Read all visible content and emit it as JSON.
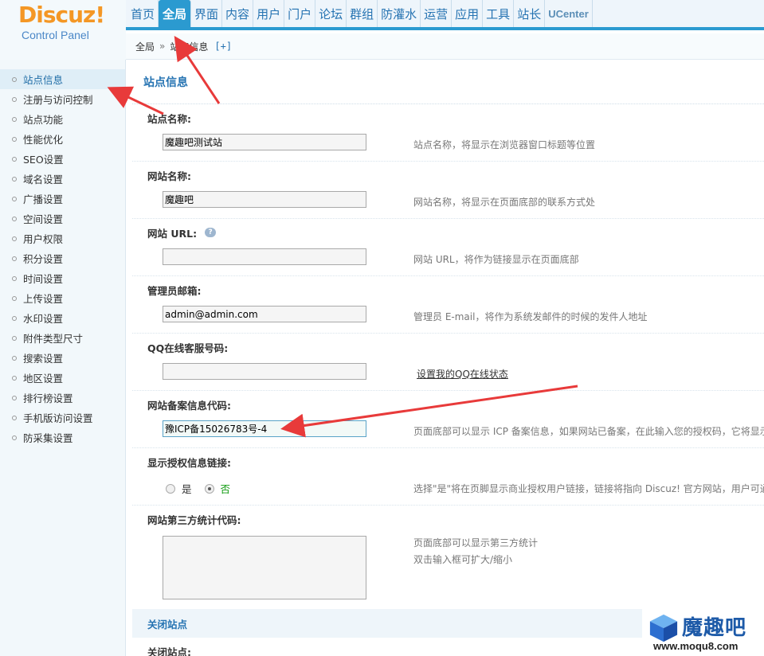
{
  "logo": {
    "brand": "Discuz!",
    "subtitle": "Control Panel"
  },
  "topnav": {
    "items": [
      {
        "label": "首页"
      },
      {
        "label": "全局"
      },
      {
        "label": "界面"
      },
      {
        "label": "内容"
      },
      {
        "label": "用户"
      },
      {
        "label": "门户"
      },
      {
        "label": "论坛"
      },
      {
        "label": "群组"
      },
      {
        "label": "防灌水"
      },
      {
        "label": "运营"
      },
      {
        "label": "应用"
      },
      {
        "label": "工具"
      },
      {
        "label": "站长"
      },
      {
        "label": "UCenter"
      }
    ],
    "active": "全局"
  },
  "breadcrumb": {
    "root": "全局",
    "separator": "»",
    "current": "站点信息",
    "add": "[+]"
  },
  "sidebar": {
    "items": [
      {
        "label": "站点信息"
      },
      {
        "label": "注册与访问控制"
      },
      {
        "label": "站点功能"
      },
      {
        "label": "性能优化"
      },
      {
        "label": "SEO设置"
      },
      {
        "label": "域名设置"
      },
      {
        "label": "广播设置"
      },
      {
        "label": "空间设置"
      },
      {
        "label": "用户权限"
      },
      {
        "label": "积分设置"
      },
      {
        "label": "时间设置"
      },
      {
        "label": "上传设置"
      },
      {
        "label": "水印设置"
      },
      {
        "label": "附件类型尺寸"
      },
      {
        "label": "搜索设置"
      },
      {
        "label": "地区设置"
      },
      {
        "label": "排行榜设置"
      },
      {
        "label": "手机版访问设置"
      },
      {
        "label": "防采集设置"
      }
    ],
    "active": "站点信息"
  },
  "main": {
    "title": "站点信息",
    "fields": {
      "site_name": {
        "label": "站点名称:",
        "value": "魔趣吧测试站",
        "tip": "站点名称，将显示在浏览器窗口标题等位置"
      },
      "web_name": {
        "label": "网站名称:",
        "value": "魔趣吧",
        "tip": "网站名称，将显示在页面底部的联系方式处"
      },
      "web_url": {
        "label": "网站 URL:",
        "value": "",
        "tip": "网站 URL，将作为链接显示在页面底部",
        "help": "?"
      },
      "admin_email": {
        "label": "管理员邮箱:",
        "value": "admin@admin.com",
        "tip": "管理员 E-mail，将作为系统发邮件的时候的发件人地址"
      },
      "qq": {
        "label": "QQ在线客服号码:",
        "value": "",
        "link": "设置我的QQ在线状态"
      },
      "icp": {
        "label": "网站备案信息代码:",
        "value": "豫ICP备15026783号-4",
        "tip": "页面底部可以显示 ICP 备案信息，如果网站已备案，在此输入您的授权码，它将显示在"
      },
      "license": {
        "label": "显示授权信息链接:",
        "opt_yes": "是",
        "opt_no": "否",
        "selected": "否",
        "tip": "选择\"是\"将在页脚显示商业授权用户链接，链接将指向 Discuz! 官方网站，用户可通过"
      },
      "stats": {
        "label": "网站第三方统计代码:",
        "tip1": "页面底部可以显示第三方统计",
        "tip2": "双击输入框可扩大/缩小"
      }
    },
    "close_section": "关闭站点",
    "close_label": "关闭站点:"
  },
  "watermark": {
    "title": "魔趣吧",
    "url": "www.moqu8.com"
  },
  "colors": {
    "accent": "#2b9ad0",
    "brand": "#f49725",
    "arrow": "#e83a3a"
  }
}
